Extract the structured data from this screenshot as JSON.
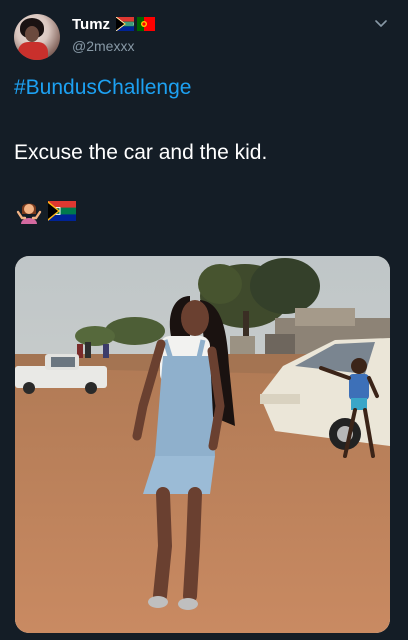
{
  "tweet": {
    "display_name": "Tumz",
    "handle": "@2mexxx",
    "flag_icons": [
      "south-africa-flag-icon",
      "portugal-flag-icon"
    ],
    "hashtag": "#BundusChallenge",
    "text": "Excuse the car and the kid.",
    "emojis": [
      "woman-shrugging-emoji",
      "south-africa-flag-emoji"
    ],
    "menu_icon": "chevron-down-icon",
    "media_description_icon": "photo"
  },
  "colors": {
    "background": "#141d26",
    "link": "#1da1f2",
    "secondary_text": "#8899a6",
    "primary_text": "#ffffff"
  }
}
